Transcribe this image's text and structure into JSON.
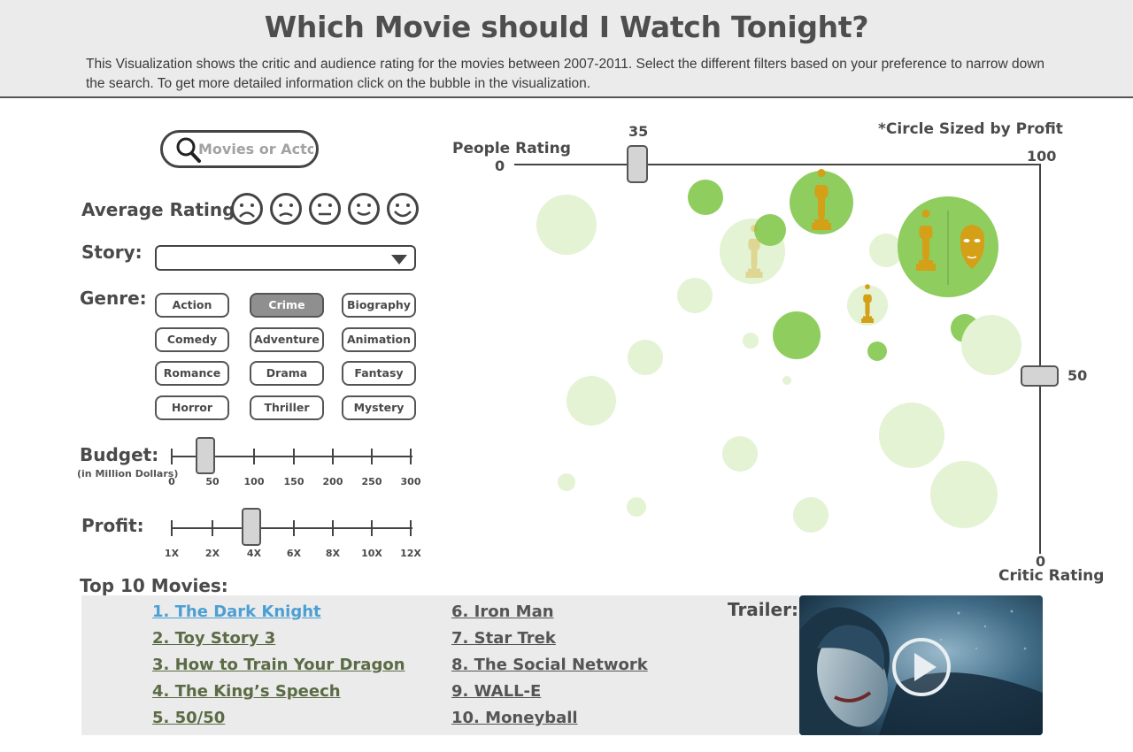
{
  "header": {
    "title": "Which Movie should I Watch Tonight?",
    "description": "This Visualization shows the critic and audience rating for the movies between 2007-2011. Select the different filters based on your preference to narrow down the search. To get more detailed information click on the bubble in the visualization."
  },
  "search": {
    "placeholder": "Movies or Actors",
    "value": ""
  },
  "filters": {
    "average_rating_label": "Average Rating:",
    "faces": [
      "very-sad-face-icon",
      "sad-face-icon",
      "neutral-face-icon",
      "happy-face-icon",
      "very-happy-face-icon"
    ],
    "story_label": "Story:",
    "story_value": "",
    "genre_label": "Genre:",
    "genres": [
      {
        "label": "Action",
        "active": false
      },
      {
        "label": "Crime",
        "active": true
      },
      {
        "label": "Biography",
        "active": false
      },
      {
        "label": "Comedy",
        "active": false
      },
      {
        "label": "Adventure",
        "active": false
      },
      {
        "label": "Animation",
        "active": false
      },
      {
        "label": "Romance",
        "active": false
      },
      {
        "label": "Drama",
        "active": false
      },
      {
        "label": "Fantasy",
        "active": false
      },
      {
        "label": "Horror",
        "active": false
      },
      {
        "label": "Thriller",
        "active": false
      },
      {
        "label": "Mystery",
        "active": false
      }
    ],
    "budget": {
      "label": "Budget:",
      "sublabel": "(in Million Dollars)",
      "ticks": [
        "0",
        "50",
        "100",
        "150",
        "200",
        "250",
        "300"
      ],
      "value": 50
    },
    "profit": {
      "label": "Profit:",
      "ticks": [
        "1X",
        "2X",
        "4X",
        "6X",
        "8X",
        "10X",
        "12X"
      ],
      "value": "4X"
    }
  },
  "top10": {
    "title": "Top 10 Movies:",
    "selected_index": 0,
    "movies": [
      "1. The Dark Knight",
      "2. Toy Story 3",
      "3. How to Train Your Dragon",
      "4. The King’s Speech",
      "5. 50/50",
      "6. Iron Man",
      "7. Star Trek",
      "8. The Social Network",
      "9. WALL-E",
      "10. Moneyball"
    ],
    "trailer_label": "Trailer:"
  },
  "chart": {
    "note": "*Circle Sized by Profit",
    "people_axis_label": "People Rating",
    "people_axis_min": "0",
    "people_axis_max": "100",
    "people_slider_value": "35",
    "critic_axis_label": "Critic Rating",
    "critic_axis_min": "0",
    "critic_slider_value": "50",
    "colors": {
      "bright": "#8fcd5e",
      "faded": "#e3f3d4",
      "award": "#d4a017"
    }
  }
}
